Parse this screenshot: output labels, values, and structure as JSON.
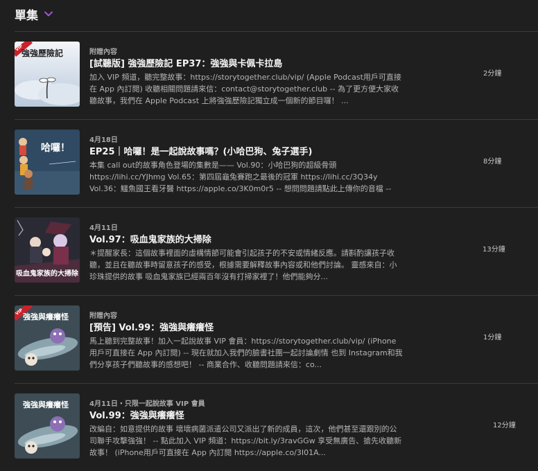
{
  "header": {
    "title": "單集",
    "chevron_icon": "chevron-down-icon",
    "accent_color": "#9b59d6"
  },
  "episodes": [
    {
      "meta": "附贈內容",
      "title": "[試聽版] 強強歷險記 EP37：強強與卡佩卡拉島",
      "description": "加入 VIP 頻道，聽完整故事：https://storytogether.club/vip/ (Apple Podcast用戶可直接在 App 內訂閱) 收聽相關問題請來信：contact@storytogether.club -- 為了更方便大家收聽故事，我們在 Apple Podcast 上將強強歷險記獨立成一個新的節目囉！ ...",
      "duration": "2分鐘",
      "thumb_text": "強強歷險記",
      "thumb_badge": "VIP"
    },
    {
      "meta": "4月18日",
      "title": "EP25｜哈囉！是一起說故事嗎？(小哈巴狗、兔子選手)",
      "description": "本集 call out的故事角色登場的集數是—— Vol.90：小哈巴狗的超級骨頭 https://lihi.cc/YJhmg Vol.65：第四屆龜兔賽跑之最後的冠軍 https://lihi.cc/3Q34y Vol.36：鱷魚國王看牙醫 https://apple.co/3K0m0r5 -- 想問問題請點此上傳你的音檔 -- 加...",
      "duration": "8分鐘",
      "thumb_text": "哈囉！"
    },
    {
      "meta": "4月11日",
      "title": "Vol.97：吸血鬼家族的大掃除",
      "description": "＊提醒家長：這個故事裡面的虛構情節可能會引起孩子的不安或情緒反應。請斟酌讓孩子收聽，並且在聽故事時留意孩子的感受，根據需要解釋故事內容或和他們討論。 靈感來自：小珍珠提供的故事 吸血鬼家族已經兩百年沒有打掃家裡了！他們能夠分...",
      "duration": "13分鐘",
      "thumb_text": "吸血鬼家族的大掃除"
    },
    {
      "meta": "附贈內容",
      "title": "[預告] Vol.99：強強與癢癢怪",
      "description": "馬上聽到完整故事！加入一起說故事 VIP 會員：https://storytogether.club/vip/ (iPhone用戶可直接在 App 內訂閱) -- 現在就加入我們的臉書社團一起討論劇情 也到 Instagram和我們分享孩子們聽故事的感想吧！ -- 商業合作、收聽問題請來信：co...",
      "duration": "1分鐘",
      "thumb_text": "強強與癢癢怪",
      "thumb_badge": "VIP"
    },
    {
      "meta": "4月11日・只限一起說故事 VIP 會員",
      "title": "Vol.99：強強與癢癢怪",
      "description": "改編自：如意提供的故事 壞壞病菌派遣公司又派出了新的成員，這次，他們甚至還跟別的公司聯手攻擊強強！ -- 點此加入 VIP 頻道：https://bit.ly/3ravGGw 享受無廣告、搶先收聽新故事！ (iPhone用戶可直接在 App 內訂閱 https://apple.co/3I01A...",
      "duration": "12分鐘",
      "thumb_text": "強強與癢癢怪"
    }
  ]
}
